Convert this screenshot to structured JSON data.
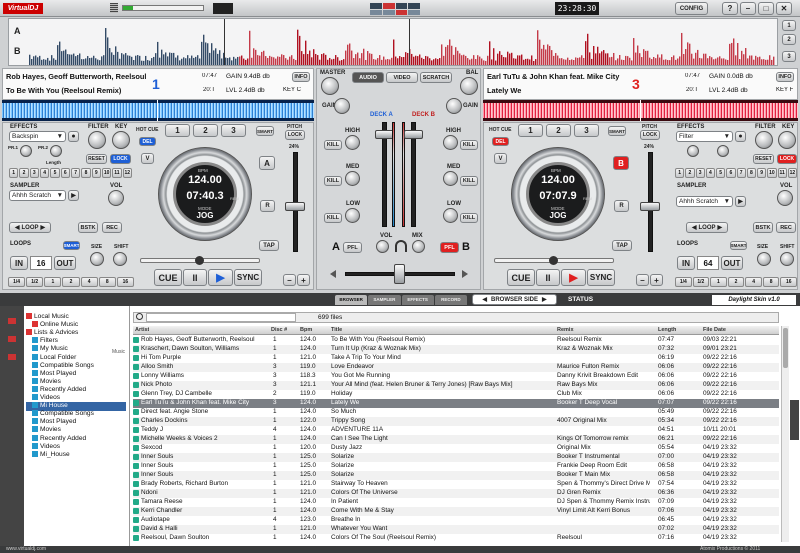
{
  "app": {
    "logo": "VirtualDJ",
    "clock": "23:28:30",
    "config": "CONFIG",
    "help": "?",
    "minimize": "–",
    "maximize": "□",
    "close": "✕",
    "cpu_label": "CPU"
  },
  "waveform": {
    "track_a": "A",
    "track_b": "B",
    "zoom": [
      "1",
      "2",
      "3"
    ]
  },
  "deckA": {
    "artist": "Rob Hayes, Geoff Butterworth, Reelsoul",
    "title": "To Be With You (Reelsoul Remix)",
    "length": "07:47",
    "remain": "20:T",
    "gain": "GAIN 9.4dB db",
    "level": "LVL 2.4dB db",
    "key": "KEY C",
    "number": "1",
    "info": "INFO",
    "bpm_label": "BPM",
    "bpm": "124.00",
    "time": "07:40.3",
    "rem": "REM",
    "mode_label": "MODE",
    "mode": "JOG",
    "pitch_label": "PITCH",
    "pitch_lock": "LOCK",
    "pitch_range": "24%",
    "hot_cue": "HOT CUE",
    "cues": [
      "1",
      "2",
      "3"
    ],
    "del": "DEL",
    "smart": "SMART",
    "v": "V",
    "a": "A",
    "r": "R",
    "tap": "TAP",
    "cue": "CUE",
    "pause": "II",
    "play": "▶",
    "sync": "SYNC",
    "minus": "–",
    "plus": "+",
    "effects": "EFFECTS",
    "effect": "Backspin",
    "filter": "FILTER",
    "key_knob": "KEY",
    "reset": "RESET",
    "lock": "LOCK",
    "fx_p1": "PR.1",
    "fx_p2": "PR.2",
    "fx_length": "Length",
    "fx_nums": [
      "1",
      "2",
      "3",
      "4",
      "5",
      "6",
      "7",
      "8",
      "9",
      "10",
      "11",
      "12"
    ],
    "sampler": "SAMPLER",
    "sample": "Ahhh Scratch",
    "vol": "VOL",
    "loop": "LOOP",
    "bstk": "BSTK",
    "rec": "REC",
    "loops": "LOOPS",
    "smart_loop": "SMART",
    "size": "SIZE",
    "shift": "SHIFT",
    "in": "IN",
    "loop_len": "16",
    "out": "OUT",
    "loop_vals": [
      "1/4",
      "1/2",
      "1",
      "2",
      "4",
      "8",
      "16"
    ]
  },
  "deckB": {
    "artist": "Earl TuTu & John Khan feat. Mike City",
    "title": "Lately We",
    "length": "07:47",
    "remain": "20:T",
    "gain": "GAIN 0.0dB db",
    "level": "LVL 2.4dB db",
    "key": "KEY F",
    "number": "3",
    "info": "INFO",
    "bpm_label": "BPM",
    "bpm": "124.00",
    "time": "07:07.9",
    "rem": "REM",
    "mode_label": "MODE",
    "mode": "JOG",
    "pitch_label": "PITCH",
    "pitch_lock": "LOCK",
    "pitch_range": "24%",
    "hot_cue": "HOT CUE",
    "cues": [
      "1",
      "2",
      "3"
    ],
    "del": "DEL",
    "smart": "SMART",
    "v": "V",
    "b": "B",
    "r": "R",
    "tap": "TAP",
    "cue": "CUE",
    "pause": "II",
    "play": "▶",
    "sync": "SYNC",
    "minus": "–",
    "plus": "+",
    "effects": "EFFECTS",
    "effect": "Filter",
    "filter": "FILTER",
    "key_knob": "KEY",
    "reset": "RESET",
    "lock": "LOCK",
    "fx_nums": [
      "1",
      "2",
      "3",
      "4",
      "5",
      "6",
      "7",
      "8",
      "9",
      "10",
      "11",
      "12"
    ],
    "sampler": "SAMPLER",
    "sample": "Ahhh Scratch",
    "vol": "VOL",
    "loop": "LOOP",
    "bstk": "BSTK",
    "rec": "REC",
    "loops": "LOOPS",
    "smart_loop": "SMART",
    "size": "SIZE",
    "shift": "SHIFT",
    "in": "IN",
    "loop_len": "64",
    "out": "OUT",
    "loop_vals": [
      "1/4",
      "1/2",
      "1",
      "2",
      "4",
      "8",
      "16"
    ]
  },
  "mixer": {
    "master": "MASTER",
    "bal": "BAL",
    "tabs": [
      "AUDIO",
      "VIDEO",
      "SCRATCH"
    ],
    "deck_a": "DECK A",
    "deck_b": "DECK B",
    "gain": "GAIN",
    "high": "HIGH",
    "med": "MED",
    "low": "LOW",
    "kill": "KILL",
    "vol": "VOL",
    "mix": "MIX",
    "pfl": "PFL",
    "a": "A",
    "b": "B"
  },
  "browser": {
    "tabs": [
      "BROWSER",
      "SAMPLER",
      "EFFECTS",
      "RECORD"
    ],
    "side_view": "BROWSER SIDE",
    "status": "STATUS",
    "brand": "Daylight Skin v1.0",
    "search": "",
    "count": "699 files",
    "columns": [
      "Artist",
      "Bpm",
      "Title",
      "Remix",
      "Length",
      "File Date"
    ],
    "col_disc": "Disc #",
    "folders": [
      "Local Music",
      "Online Music",
      "Lists & Advices",
      "Filters",
      "My Music",
      "Local Folder",
      "Compatible Songs",
      "Most Played",
      "Movies",
      "Recently Added",
      "Videos",
      "Mi House",
      "Compatible Songs",
      "Most Played",
      "Movies",
      "Recently Added",
      "Videos",
      "Mi_House"
    ],
    "folder_tag": "Music",
    "rows": [
      [
        "Rob Hayes, Geoff Butterworth, Reelsoul",
        "1",
        "124.0",
        "To Be With You (Reelsoul Remix)",
        "Reelsoul Remix",
        "07:47",
        "09/03 22:21"
      ],
      [
        "Kraschert, Dawn Soulton, Williams",
        "1",
        "124.0",
        "Turn It Up (Kraz & Woznak Mix)",
        "Kraz & Woznak Mix",
        "07:32",
        "09/01 23:21"
      ],
      [
        "Hi Tom Purple",
        "1",
        "121.0",
        "Take A Trip To Your Mind",
        "",
        "06:19",
        "09/22 22:16"
      ],
      [
        "Alloo Smith",
        "3",
        "119.0",
        "Love Endeavor",
        "Maurice Fulton Remix",
        "06:06",
        "09/22 22:16"
      ],
      [
        "Lonny Williams",
        "3",
        "118.3",
        "You Got Me Running",
        "Danny Krivit Breakdown Edit",
        "06:06",
        "09/22 22:16"
      ],
      [
        "Nick Photo",
        "3",
        "121.1",
        "Your All Mind (feat. Helen Bruner & Terry Jones) [Raw Bays Mix]",
        "Raw Bays Mix",
        "06:06",
        "09/22 22:16"
      ],
      [
        "Glenn Trey, DJ Cambelle",
        "2",
        "119.0",
        "Holiday",
        "Club Mix",
        "06:06",
        "09/22 22:16"
      ],
      [
        "Earl TuTu & John Khan feat. Mike City",
        "3",
        "124.0",
        "Lately We",
        "Booker T Deep Vocal",
        "07:07",
        "09/22 22:16"
      ],
      [
        "Direct feat. Angie Stone",
        "1",
        "124.0",
        "So Much",
        "",
        "05:49",
        "09/22 22:16"
      ],
      [
        "Charles Dockins",
        "1",
        "122.0",
        "Trippy Song",
        "4007 Original Mix",
        "05:34",
        "09/22 22:16"
      ],
      [
        "Teddy J",
        "4",
        "124.0",
        "ADVENTURE 11A",
        "",
        "04:51",
        "10/11 20:01"
      ],
      [
        "Michelle Weeks & Voices 2",
        "1",
        "124.0",
        "Can I See The Light",
        "Kings Of Tomorrow remix",
        "06:21",
        "09/22 22:16"
      ],
      [
        "Sexcod",
        "1",
        "120.0",
        "Dusty Jazz",
        "Original Mix",
        "05:54",
        "04/19 23:32"
      ],
      [
        "Inner Souls",
        "1",
        "125.0",
        "Solarize",
        "Booker T Instrumental",
        "07:00",
        "04/19 23:32"
      ],
      [
        "Inner Souls",
        "1",
        "125.0",
        "Solarize",
        "Frankie Deep Room Edit",
        "06:58",
        "04/19 23:32"
      ],
      [
        "Inner Souls",
        "1",
        "125.0",
        "Solarize",
        "Booker T Main Mix",
        "06:58",
        "04/19 23:32"
      ],
      [
        "Brady Roberts, Richard Burton",
        "1",
        "121.0",
        "Stairway To Heaven",
        "Spen & Thommy's Direct Drive Mix",
        "07:54",
        "04/19 23:32"
      ],
      [
        "Ndoni",
        "1",
        "121.0",
        "Colors Of The Universe",
        "DJ Gren Remix",
        "06:36",
        "04/19 23:32"
      ],
      [
        "Tamara Reese",
        "1",
        "124.0",
        "In Patient",
        "DJ Spen & Thommy Remix Instrumental",
        "07:09",
        "04/19 23:32"
      ],
      [
        "Kerri Chandler",
        "1",
        "124.0",
        "Come With Me & Stay",
        "Vinyl Limit Alt Kerri Bonus",
        "07:06",
        "04/19 23:32"
      ],
      [
        "Audiotape",
        "4",
        "123.0",
        "Breathe In",
        "",
        "06:45",
        "04/19 23:32"
      ],
      [
        "David & Halli",
        "1",
        "121.0",
        "Whatever You Want",
        "",
        "07:02",
        "04/19 23:32"
      ],
      [
        "Reelsoul, Dawn Soulton",
        "1",
        "124.0",
        "Colors Of The Soul (Reelsoul Remix)",
        "Reelsoul",
        "07:16",
        "04/19 23:32"
      ]
    ],
    "footer_left": "www.virtualdj.com",
    "footer_right": "Atomix Productions © 2011"
  }
}
